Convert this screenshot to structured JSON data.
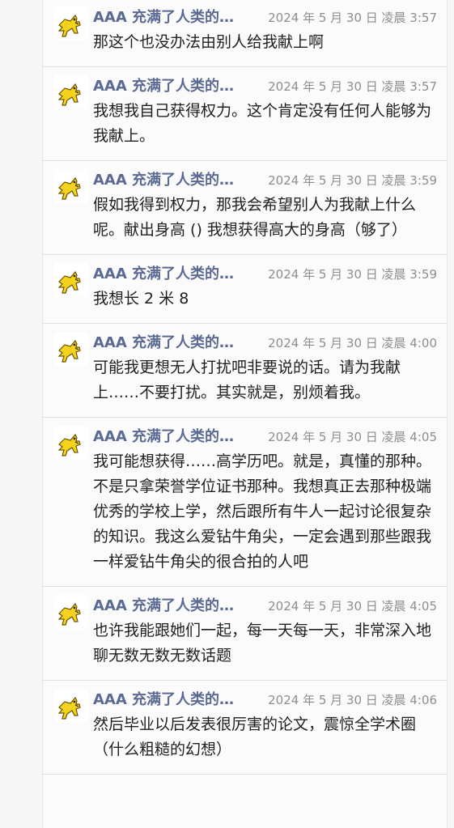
{
  "icons": {
    "avatar": "yellow-cat-avatar-icon"
  },
  "colors": {
    "sender": "#5b6a92",
    "timestamp": "#8e8e8e",
    "text": "#1f1f1f",
    "avatar": "#f5d21e"
  },
  "messages": [
    {
      "sender": "AAA 充满了人类的…",
      "time": "2024 年 5 月 30 日 凌晨 3:57",
      "text": "那这个也没办法由别人给我献上啊"
    },
    {
      "sender": "AAA 充满了人类的…",
      "time": "2024 年 5 月 30 日 凌晨 3:57",
      "text": "我想我自己获得权力。这个肯定没有任何人能够为我献上。"
    },
    {
      "sender": "AAA 充满了人类的…",
      "time": "2024 年 5 月 30 日 凌晨 3:59",
      "text": "假如我得到权力，那我会希望别人为我献上什么呢。献出身高 () 我想获得高大的身高（够了）"
    },
    {
      "sender": "AAA 充满了人类的…",
      "time": "2024 年 5 月 30 日 凌晨 3:59",
      "text": "我想长 2 米 8"
    },
    {
      "sender": "AAA 充满了人类的…",
      "time": "2024 年 5 月 30 日 凌晨 4:00",
      "text": "可能我更想无人打扰吧非要说的话。请为我献上……不要打扰。其实就是，别烦着我。"
    },
    {
      "sender": "AAA 充满了人类的…",
      "time": "2024 年 5 月 30 日 凌晨 4:05",
      "text": "我可能想获得……高学历吧。就是，真懂的那种。不是只拿荣誉学位证书那种。我想真正去那种极端优秀的学校上学，然后跟所有牛人一起讨论很复杂的知识。我这么爱钻牛角尖，一定会遇到那些跟我一样爱钻牛角尖的很合拍的人吧"
    },
    {
      "sender": "AAA 充满了人类的…",
      "time": "2024 年 5 月 30 日 凌晨 4:05",
      "text": "也许我能跟她们一起，每一天每一天，非常深入地聊无数无数无数话题"
    },
    {
      "sender": "AAA 充满了人类的…",
      "time": "2024 年 5 月 30 日 凌晨 4:06",
      "text": "然后毕业以后发表很厉害的论文，震惊全学术圈（什么粗糙的幻想）"
    }
  ]
}
